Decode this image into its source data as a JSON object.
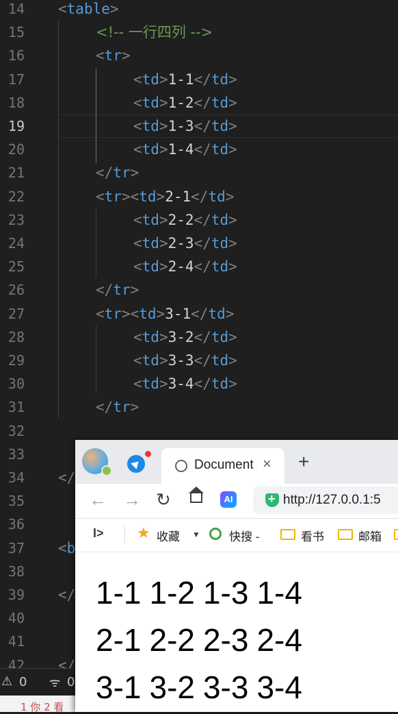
{
  "editor": {
    "active_line": 19,
    "lines": [
      {
        "n": "14",
        "indent": 0,
        "parts": [
          [
            "br",
            "<"
          ],
          [
            "tag",
            "table"
          ],
          [
            "br",
            ">"
          ]
        ]
      },
      {
        "n": "15",
        "indent": 1,
        "parts": [
          [
            "cmt",
            "<!-- 一行四列 -->"
          ]
        ]
      },
      {
        "n": "16",
        "indent": 1,
        "parts": [
          [
            "br",
            "<"
          ],
          [
            "tag",
            "tr"
          ],
          [
            "br",
            ">"
          ]
        ]
      },
      {
        "n": "17",
        "indent": 2,
        "parts": [
          [
            "br",
            "<"
          ],
          [
            "tag",
            "td"
          ],
          [
            "br",
            ">"
          ],
          [
            "txt",
            "1-1"
          ],
          [
            "br",
            "</"
          ],
          [
            "tag",
            "td"
          ],
          [
            "br",
            ">"
          ]
        ]
      },
      {
        "n": "18",
        "indent": 2,
        "parts": [
          [
            "br",
            "<"
          ],
          [
            "tag",
            "td"
          ],
          [
            "br",
            ">"
          ],
          [
            "txt",
            "1-2"
          ],
          [
            "br",
            "</"
          ],
          [
            "tag",
            "td"
          ],
          [
            "br",
            ">"
          ]
        ]
      },
      {
        "n": "19",
        "indent": 2,
        "parts": [
          [
            "br",
            "<"
          ],
          [
            "tag",
            "td"
          ],
          [
            "br",
            ">"
          ],
          [
            "txt",
            "1-3"
          ],
          [
            "br",
            "</"
          ],
          [
            "tag",
            "td"
          ],
          [
            "br",
            ">"
          ]
        ]
      },
      {
        "n": "20",
        "indent": 2,
        "parts": [
          [
            "br",
            "<"
          ],
          [
            "tag",
            "td"
          ],
          [
            "br",
            ">"
          ],
          [
            "txt",
            "1-4"
          ],
          [
            "br",
            "</"
          ],
          [
            "tag",
            "td"
          ],
          [
            "br",
            ">"
          ]
        ]
      },
      {
        "n": "21",
        "indent": 1,
        "parts": [
          [
            "br",
            "</"
          ],
          [
            "tag",
            "tr"
          ],
          [
            "br",
            ">"
          ]
        ]
      },
      {
        "n": "22",
        "indent": 1,
        "parts": [
          [
            "br",
            "<"
          ],
          [
            "tag",
            "tr"
          ],
          [
            "br",
            "><"
          ],
          [
            "tag",
            "td"
          ],
          [
            "br",
            ">"
          ],
          [
            "txt",
            "2-1"
          ],
          [
            "br",
            "</"
          ],
          [
            "tag",
            "td"
          ],
          [
            "br",
            ">"
          ]
        ]
      },
      {
        "n": "23",
        "indent": 2,
        "parts": [
          [
            "br",
            "<"
          ],
          [
            "tag",
            "td"
          ],
          [
            "br",
            ">"
          ],
          [
            "txt",
            "2-2"
          ],
          [
            "br",
            "</"
          ],
          [
            "tag",
            "td"
          ],
          [
            "br",
            ">"
          ]
        ]
      },
      {
        "n": "24",
        "indent": 2,
        "parts": [
          [
            "br",
            "<"
          ],
          [
            "tag",
            "td"
          ],
          [
            "br",
            ">"
          ],
          [
            "txt",
            "2-3"
          ],
          [
            "br",
            "</"
          ],
          [
            "tag",
            "td"
          ],
          [
            "br",
            ">"
          ]
        ]
      },
      {
        "n": "25",
        "indent": 2,
        "parts": [
          [
            "br",
            "<"
          ],
          [
            "tag",
            "td"
          ],
          [
            "br",
            ">"
          ],
          [
            "txt",
            "2-4"
          ],
          [
            "br",
            "</"
          ],
          [
            "tag",
            "td"
          ],
          [
            "br",
            ">"
          ]
        ]
      },
      {
        "n": "26",
        "indent": 1,
        "parts": [
          [
            "br",
            "</"
          ],
          [
            "tag",
            "tr"
          ],
          [
            "br",
            ">"
          ]
        ]
      },
      {
        "n": "27",
        "indent": 1,
        "parts": [
          [
            "br",
            "<"
          ],
          [
            "tag",
            "tr"
          ],
          [
            "br",
            "><"
          ],
          [
            "tag",
            "td"
          ],
          [
            "br",
            ">"
          ],
          [
            "txt",
            "3-1"
          ],
          [
            "br",
            "</"
          ],
          [
            "tag",
            "td"
          ],
          [
            "br",
            ">"
          ]
        ]
      },
      {
        "n": "28",
        "indent": 2,
        "parts": [
          [
            "br",
            "<"
          ],
          [
            "tag",
            "td"
          ],
          [
            "br",
            ">"
          ],
          [
            "txt",
            "3-2"
          ],
          [
            "br",
            "</"
          ],
          [
            "tag",
            "td"
          ],
          [
            "br",
            ">"
          ]
        ]
      },
      {
        "n": "29",
        "indent": 2,
        "parts": [
          [
            "br",
            "<"
          ],
          [
            "tag",
            "td"
          ],
          [
            "br",
            ">"
          ],
          [
            "txt",
            "3-3"
          ],
          [
            "br",
            "</"
          ],
          [
            "tag",
            "td"
          ],
          [
            "br",
            ">"
          ]
        ]
      },
      {
        "n": "30",
        "indent": 2,
        "parts": [
          [
            "br",
            "<"
          ],
          [
            "tag",
            "td"
          ],
          [
            "br",
            ">"
          ],
          [
            "txt",
            "3-4"
          ],
          [
            "br",
            "</"
          ],
          [
            "tag",
            "td"
          ],
          [
            "br",
            ">"
          ]
        ]
      },
      {
        "n": "31",
        "indent": 1,
        "parts": [
          [
            "br",
            "</"
          ],
          [
            "tag",
            "tr"
          ],
          [
            "br",
            ">"
          ]
        ]
      },
      {
        "n": "32",
        "indent": 0,
        "parts": []
      },
      {
        "n": "33",
        "indent": 0,
        "parts": []
      },
      {
        "n": "34",
        "indent": 0,
        "parts": [
          [
            "br",
            "</"
          ]
        ]
      },
      {
        "n": "35",
        "indent": 0,
        "parts": []
      },
      {
        "n": "36",
        "indent": 0,
        "parts": []
      },
      {
        "n": "37",
        "indent": 0,
        "parts": [
          [
            "br",
            "<"
          ],
          [
            "tag",
            "b"
          ]
        ]
      },
      {
        "n": "38",
        "indent": 0,
        "parts": []
      },
      {
        "n": "39",
        "indent": 0,
        "parts": [
          [
            "br",
            "</"
          ]
        ]
      },
      {
        "n": "40",
        "indent": 0,
        "parts": []
      },
      {
        "n": "41",
        "indent": 0,
        "parts": []
      },
      {
        "n": "42",
        "indent": 0,
        "parts": [
          [
            "br",
            "</"
          ]
        ]
      }
    ]
  },
  "statusbar": {
    "problems_icon": "warning-icon",
    "problems_count": "0",
    "ports_icon": "broadcast-icon",
    "ports_count": "0"
  },
  "bottom_strip_text": "1 你 2 看",
  "browser": {
    "tab_title": "Document",
    "tab_close": "×",
    "new_tab": "+",
    "url": "http://127.0.0.1:5",
    "ai_label": "AI",
    "bookmarks": [
      {
        "label": "收藏"
      },
      {
        "label": "快搜 -"
      },
      {
        "label": "看书"
      },
      {
        "label": "邮箱"
      }
    ],
    "table_rows": [
      [
        "1-1",
        "1-2",
        "1-3",
        "1-4"
      ],
      [
        "2-1",
        "2-2",
        "2-3",
        "2-4"
      ],
      [
        "3-1",
        "3-2",
        "3-3",
        "3-4"
      ]
    ]
  }
}
